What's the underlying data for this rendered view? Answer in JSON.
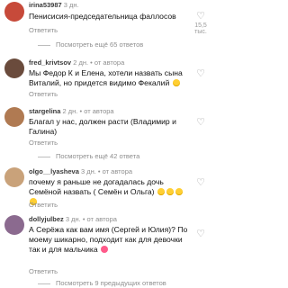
{
  "comments": [
    {
      "username": "irina53987",
      "time": "3 дн.",
      "author_badge": "",
      "text": "Пенисисия-председательница фаллосов",
      "reply_label": "Ответить",
      "likes": "15,5 тыс.",
      "view_more": "Посмотреть ещё 65 ответов",
      "avatar_color": "#c74a3a"
    },
    {
      "username": "fred_krivtsov",
      "time": "2 дн.",
      "author_badge": "от автора",
      "text": "Мы Федор К и Елена, хотели назвать сына Виталий, но придется видимо Фекалий",
      "reply_label": "Ответить",
      "likes": "",
      "view_more": "",
      "avatar_color": "#6a4b3c"
    },
    {
      "username": "stargelina",
      "time": "2 дн.",
      "author_badge": "от автора",
      "text": "Благал у нас, должен расти (Владимир и Галина)",
      "reply_label": "Ответить",
      "likes": "",
      "view_more": "Посмотреть ещё 42 ответа",
      "avatar_color": "#b07a52"
    },
    {
      "username": "olgo__lyasheva",
      "time": "3 дн.",
      "author_badge": "от автора",
      "text": "почему я раньше не догадалась дочь Семёной назвать ( Семён и Ольга)",
      "reply_label": "Ответить",
      "likes": "",
      "view_more": "",
      "avatar_color": "#c9a27a"
    },
    {
      "username": "dollyjulbez",
      "time": "3 дн.",
      "author_badge": "от автора",
      "text": "А Серёжа как вам имя (Сергей и Юлия)? По моему шикарно, подходит как для девочки так и для мальчика",
      "reply_label": "Ответить",
      "likes": "",
      "view_more": "Посмотреть 9 предыдущих ответов",
      "avatar_color": "#8b6a8f"
    }
  ]
}
